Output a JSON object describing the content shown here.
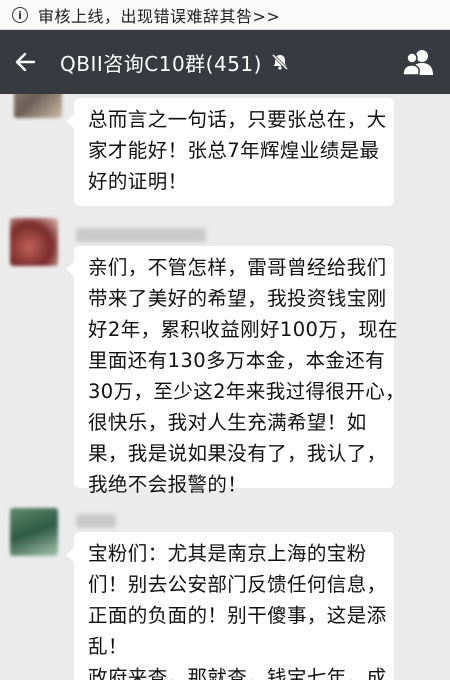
{
  "banner": {
    "icon": "info-icon",
    "text": "审核上线，出现错误难辞其咎>>"
  },
  "header": {
    "back_icon": "back-arrow-icon",
    "title": "QBII咨询C10群(451)",
    "mute_icon": "mute-bell-icon",
    "members_icon": "group-members-icon",
    "background": "#393a3f"
  },
  "messages": [
    {
      "lines": [
        "总而言之一句话，只要张总在，大",
        "家才能好！张总7年辉煌业绩是最",
        "好的证明！"
      ]
    },
    {
      "lines": [
        "亲们，不管怎样，雷哥曾经给我们",
        "带来了美好的希望，我投资钱宝刚",
        "好2年，累积收益刚好100万，现在",
        "里面还有130多万本金，本金还有",
        "30万，至少这2年来我过得很开心，",
        "很快乐，我对人生充满希望！如",
        "果，我是说如果没有了，我认了，",
        "我绝不会报警的！"
      ]
    },
    {
      "lines": [
        "宝粉们：尤其是南京上海的宝粉",
        "们！别去公安部门反馈任何信息，",
        "正面的负面的！别干傻事，这是添",
        "乱！",
        "政府来查，那就查，钱宝七年，成"
      ]
    }
  ]
}
